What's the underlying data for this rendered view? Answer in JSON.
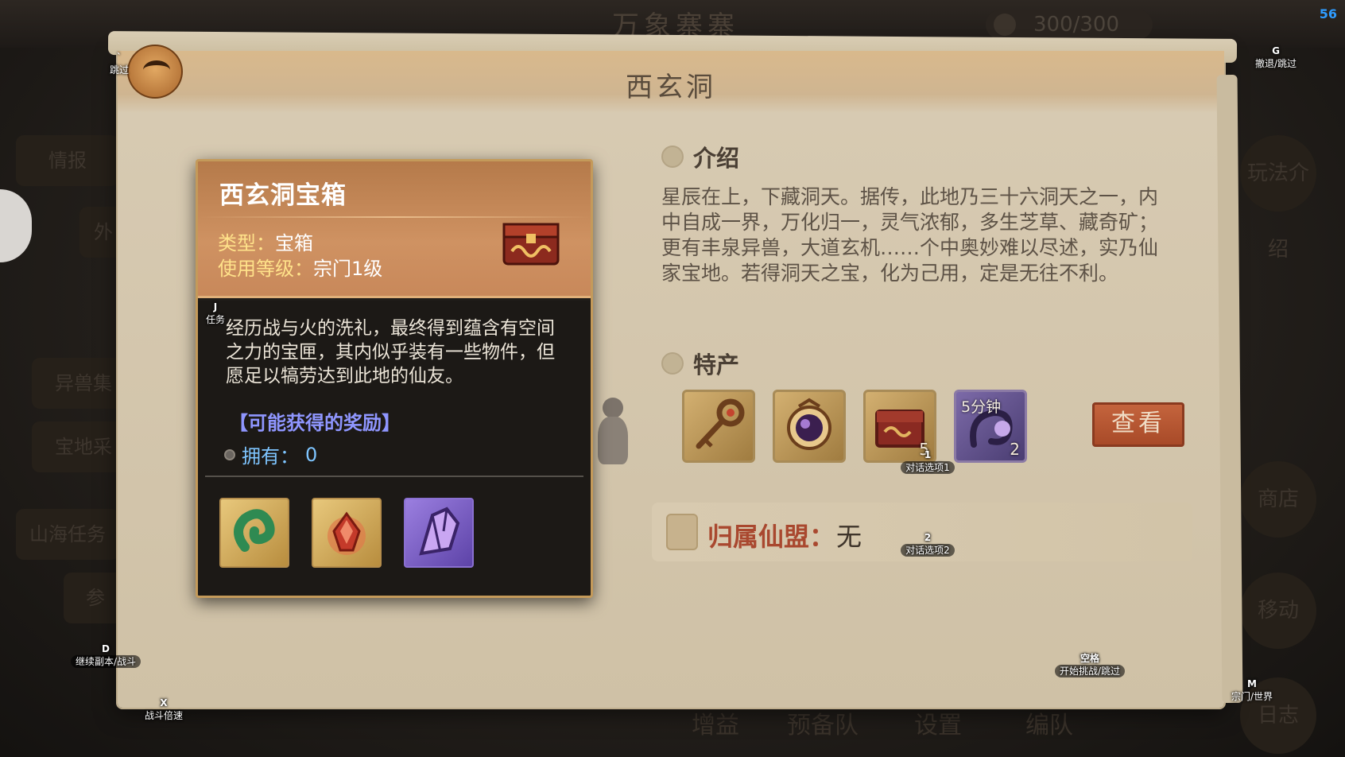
{
  "fps": "56",
  "background": {
    "banner_title": "万象寨寨",
    "stamina": "300/300",
    "left_buttons": [
      "情报",
      "外",
      "异兽集",
      "宝地采",
      "山海任务",
      "参"
    ],
    "right_buttons": [
      "玩法介绍",
      "商店",
      "移动",
      "日志"
    ],
    "bottom_buttons": [
      "增益",
      "预备队",
      "设置",
      "编队"
    ]
  },
  "dialog": {
    "title": "西玄洞",
    "intro": {
      "heading": "介绍",
      "text": "星辰在上，下藏洞天。据传，此地乃三十六洞天之一，内中自成一界，万化归一，灵气浓郁，多生芝草、藏奇矿；更有丰泉异兽，大道玄机……个中奥妙难以尽述，实乃仙家宝地。若得洞天之宝，化为己用，定是无往不利。"
    },
    "products": {
      "heading": "特产",
      "items": [
        {
          "icon": "key-icon",
          "count": ""
        },
        {
          "icon": "orb-icon",
          "count": ""
        },
        {
          "icon": "chest-icon",
          "count": "5"
        },
        {
          "icon": "swirl-icon",
          "count": "2",
          "timer": "5分钟"
        }
      ],
      "view_label": "查看"
    },
    "alliance": {
      "label": "归属仙盟：",
      "value": "无"
    }
  },
  "tooltip": {
    "name": "西玄洞宝箱",
    "type_key": "类型：",
    "type_value": "宝箱",
    "level_key": "使用等级：",
    "level_value": "宗门1级",
    "description": "经历战与火的洗礼，最终得到蕴含有空间之力的宝匣，其内似乎装有一些物件，但愿足以犒劳达到此地的仙友。",
    "rewards_title": "【可能获得的奖励】",
    "own_label": "拥有：",
    "own_value": "0",
    "rewards": [
      {
        "icon": "jade-pendant-icon"
      },
      {
        "icon": "fire-gem-icon"
      },
      {
        "icon": "purple-crystal-icon"
      }
    ]
  },
  "hints": {
    "skip": {
      "key": "`",
      "label": "跳过"
    },
    "retreat": {
      "key": "G",
      "label": "撤退/跳过"
    },
    "task": {
      "key": "J",
      "label": "任务"
    },
    "option1": {
      "key": "1",
      "label": "对话选项1"
    },
    "option2": {
      "key": "2",
      "label": "对话选项2"
    },
    "continue": {
      "key": "D",
      "label": "继续副本/战斗"
    },
    "speed": {
      "key": "X",
      "label": "战斗倍速"
    },
    "space": {
      "key": "空格",
      "label": "开始挑战/跳过"
    },
    "world": {
      "key": "M",
      "label": "宗门/世界"
    }
  }
}
